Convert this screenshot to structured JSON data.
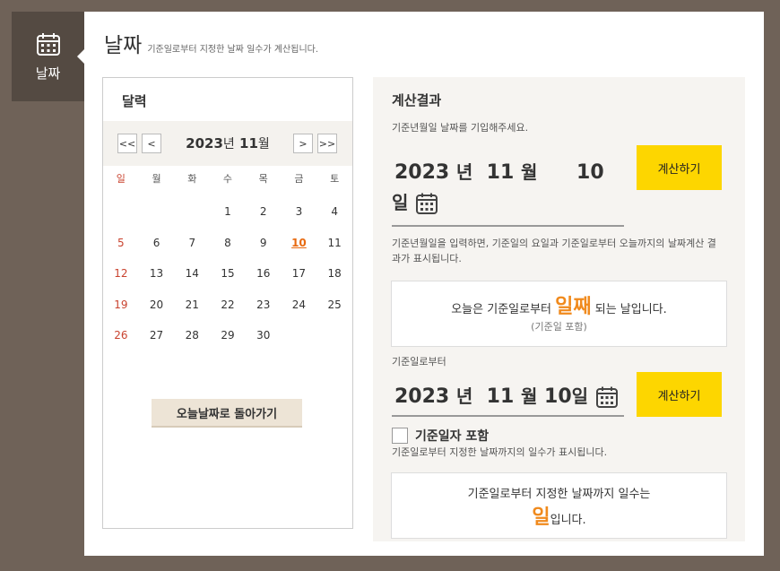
{
  "sidebar": {
    "tab_label": "날짜",
    "icon": "calendar-icon"
  },
  "header": {
    "title": "날짜",
    "subtitle": "기준일로부터 지정한 날짜 일수가 계산됩니다."
  },
  "calendar": {
    "title": "달력",
    "nav": {
      "prev_year": "<<",
      "prev_month": "<",
      "next_month": ">",
      "next_year": ">>"
    },
    "year": "2023",
    "year_unit": "년",
    "month": "11",
    "month_unit": "월",
    "weekdays": [
      "일",
      "월",
      "화",
      "수",
      "목",
      "금",
      "토"
    ],
    "days": [
      "",
      "",
      "",
      "1",
      "2",
      "3",
      "4",
      "5",
      "6",
      "7",
      "8",
      "9",
      "10",
      "11",
      "12",
      "13",
      "14",
      "15",
      "16",
      "17",
      "18",
      "19",
      "20",
      "21",
      "22",
      "23",
      "24",
      "25",
      "26",
      "27",
      "28",
      "29",
      "30"
    ],
    "today": "10",
    "today_button": "오늘날짜로 돌아가기"
  },
  "result": {
    "title": "계산결과",
    "section1": {
      "hint": "기준년월일 날짜를 기입해주세요.",
      "year": "2023",
      "year_unit": "년",
      "month": "11",
      "month_unit": "월",
      "day": "10",
      "day_unit": "일",
      "button": "계산하기",
      "desc": "기준년월일을 입력하면, 기준일의 요일과 기준일로부터 오늘까지의 날짜계산 결과가 표시됩니다.",
      "result_before": "오늘은 기준일로부터 ",
      "result_highlight": "일째",
      "result_after": " 되는 날입니다.",
      "result_note": "(기준일 포함)"
    },
    "section2": {
      "label": "기준일로부터",
      "year": "2023",
      "year_unit": "년",
      "month": "11",
      "month_unit": "월",
      "day": "10",
      "day_unit": "일",
      "button": "계산하기",
      "checkbox_label": "기준일자 포함",
      "checkbox_checked": false,
      "desc": "기준일로부터 지정한 날짜까지의 일수가 표시됩니다.",
      "result_line1": "기준일로부터 지정한 날짜까지 일수는",
      "result_highlight": "일",
      "result_after": "입니다."
    }
  },
  "colors": {
    "accent": "#fdd600",
    "highlight": "#f08a1d",
    "sunday": "#c9432f",
    "background": "#6f6258"
  }
}
